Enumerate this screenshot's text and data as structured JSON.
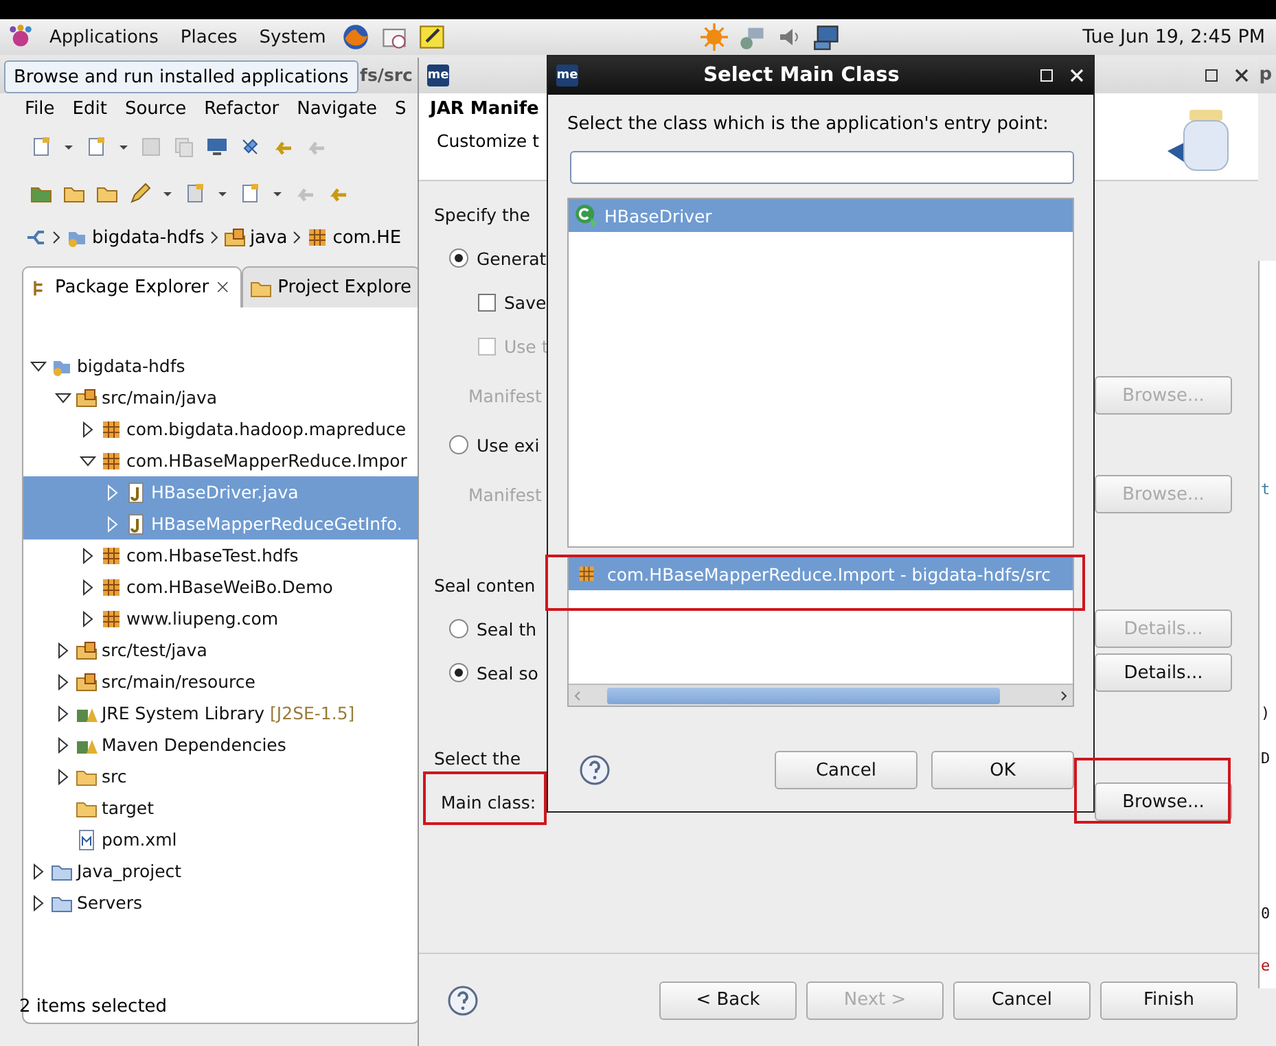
{
  "top_panel": {
    "menus": [
      "Applications",
      "Places",
      "System"
    ],
    "clock": "Tue Jun 19,  2:45 PM"
  },
  "tooltip": "Browse and run installed applications",
  "eclipse": {
    "title": "fs/src",
    "side_title": "p",
    "menu": [
      "File",
      "Edit",
      "Source",
      "Refactor",
      "Navigate",
      "S"
    ],
    "breadcrumb": [
      "bigdata-hdfs",
      "java",
      "com.HE"
    ],
    "view_tabs": [
      {
        "label": "Package Explorer",
        "selected": true
      },
      {
        "label": "Project Explore",
        "selected": false
      }
    ],
    "tree": [
      {
        "label": "bigdata-hdfs",
        "kind": "project",
        "expanded": true,
        "selected": false,
        "children": [
          {
            "label": "src/main/java",
            "kind": "source",
            "expanded": true,
            "selected": false,
            "children": [
              {
                "label": "com.bigdata.hadoop.mapreduce",
                "kind": "package",
                "expanded": false,
                "selected": false
              },
              {
                "label": "com.HBaseMapperReduce.Impor",
                "kind": "package",
                "expanded": true,
                "selected": false,
                "children": [
                  {
                    "label": "HBaseDriver.java",
                    "kind": "java",
                    "expanded": false,
                    "selected": true
                  },
                  {
                    "label": "HBaseMapperReduceGetInfo.",
                    "kind": "java",
                    "expanded": false,
                    "selected": true
                  }
                ]
              },
              {
                "label": "com.HbaseTest.hdfs",
                "kind": "package",
                "expanded": false,
                "selected": false
              },
              {
                "label": "com.HBaseWeiBo.Demo",
                "kind": "package",
                "expanded": false,
                "selected": false
              },
              {
                "label": "www.liupeng.com",
                "kind": "package",
                "expanded": false,
                "selected": false
              }
            ]
          },
          {
            "label": "src/test/java",
            "kind": "source",
            "expanded": false,
            "selected": false
          },
          {
            "label": "src/main/resource",
            "kind": "source",
            "expanded": false,
            "selected": false
          },
          {
            "label": "JRE System Library",
            "suffix": "[J2SE-1.5]",
            "kind": "library",
            "expanded": false,
            "selected": false
          },
          {
            "label": "Maven Dependencies",
            "kind": "library",
            "expanded": false,
            "selected": false
          },
          {
            "label": "src",
            "kind": "folder",
            "expanded": false,
            "selected": false
          },
          {
            "label": "target",
            "kind": "folder",
            "selected": false
          },
          {
            "label": "pom.xml",
            "kind": "xml",
            "selected": false
          }
        ]
      },
      {
        "label": "Java_project",
        "kind": "project_folder",
        "expanded": false,
        "selected": false
      },
      {
        "label": "Servers",
        "kind": "project_folder",
        "expanded": false,
        "selected": false
      }
    ],
    "status": "2 items selected",
    "editor_fragments": [
      {
        "text": "t",
        "kind": "keyword"
      },
      {
        "text": ")",
        "kind": "code"
      },
      {
        "text": "D",
        "kind": "code"
      },
      {
        "text": "0",
        "kind": "code"
      },
      {
        "text": "e",
        "kind": "error"
      }
    ]
  },
  "wizard": {
    "app_icon": "me",
    "heading": "JAR Manife",
    "description": "Customize t",
    "rows": [
      {
        "kind": "heading",
        "text": "Specify the"
      },
      {
        "kind": "radio",
        "text": "Generat",
        "selected": true,
        "disabled": false
      },
      {
        "kind": "checkbox",
        "text": "Save",
        "checked": false,
        "disabled": false
      },
      {
        "kind": "checkbox",
        "text": "Use t",
        "checked": false,
        "disabled": true
      },
      {
        "kind": "field_label",
        "text": "Manifest",
        "disabled": true,
        "button": {
          "label": "Browse...",
          "disabled": true
        }
      },
      {
        "kind": "radio",
        "text": "Use exi",
        "selected": false,
        "disabled": false
      },
      {
        "kind": "field_label",
        "text": "Manifest",
        "disabled": true,
        "button": {
          "label": "Browse...",
          "disabled": true
        }
      },
      {
        "kind": "heading",
        "text": "Seal conten"
      },
      {
        "kind": "radio",
        "text": "Seal th",
        "selected": false,
        "disabled": false,
        "button": {
          "label": "Details...",
          "disabled": true
        }
      },
      {
        "kind": "radio",
        "text": "Seal so",
        "selected": true,
        "disabled": false,
        "button": {
          "label": "Details...",
          "disabled": false
        }
      },
      {
        "kind": "heading",
        "text": "Select the"
      },
      {
        "kind": "field",
        "text": "Main class:",
        "disabled": false,
        "button": {
          "label": "Browse...",
          "disabled": false
        }
      }
    ],
    "buttons": [
      {
        "label": "< Back",
        "disabled": false
      },
      {
        "label": "Next >",
        "disabled": true
      },
      {
        "label": "Cancel",
        "disabled": false
      },
      {
        "label": "Finish",
        "disabled": false
      }
    ]
  },
  "dialog": {
    "app_icon": "me",
    "title": "Select Main Class",
    "prompt": "Select the class which is the application's entry point:",
    "classes": [
      {
        "label": "HBaseDriver",
        "selected": true
      }
    ],
    "packages": [
      {
        "label": "com.HBaseMapperReduce.Import - bigdata-hdfs/src",
        "selected": true
      }
    ],
    "buttons": [
      "Cancel",
      "OK"
    ]
  }
}
